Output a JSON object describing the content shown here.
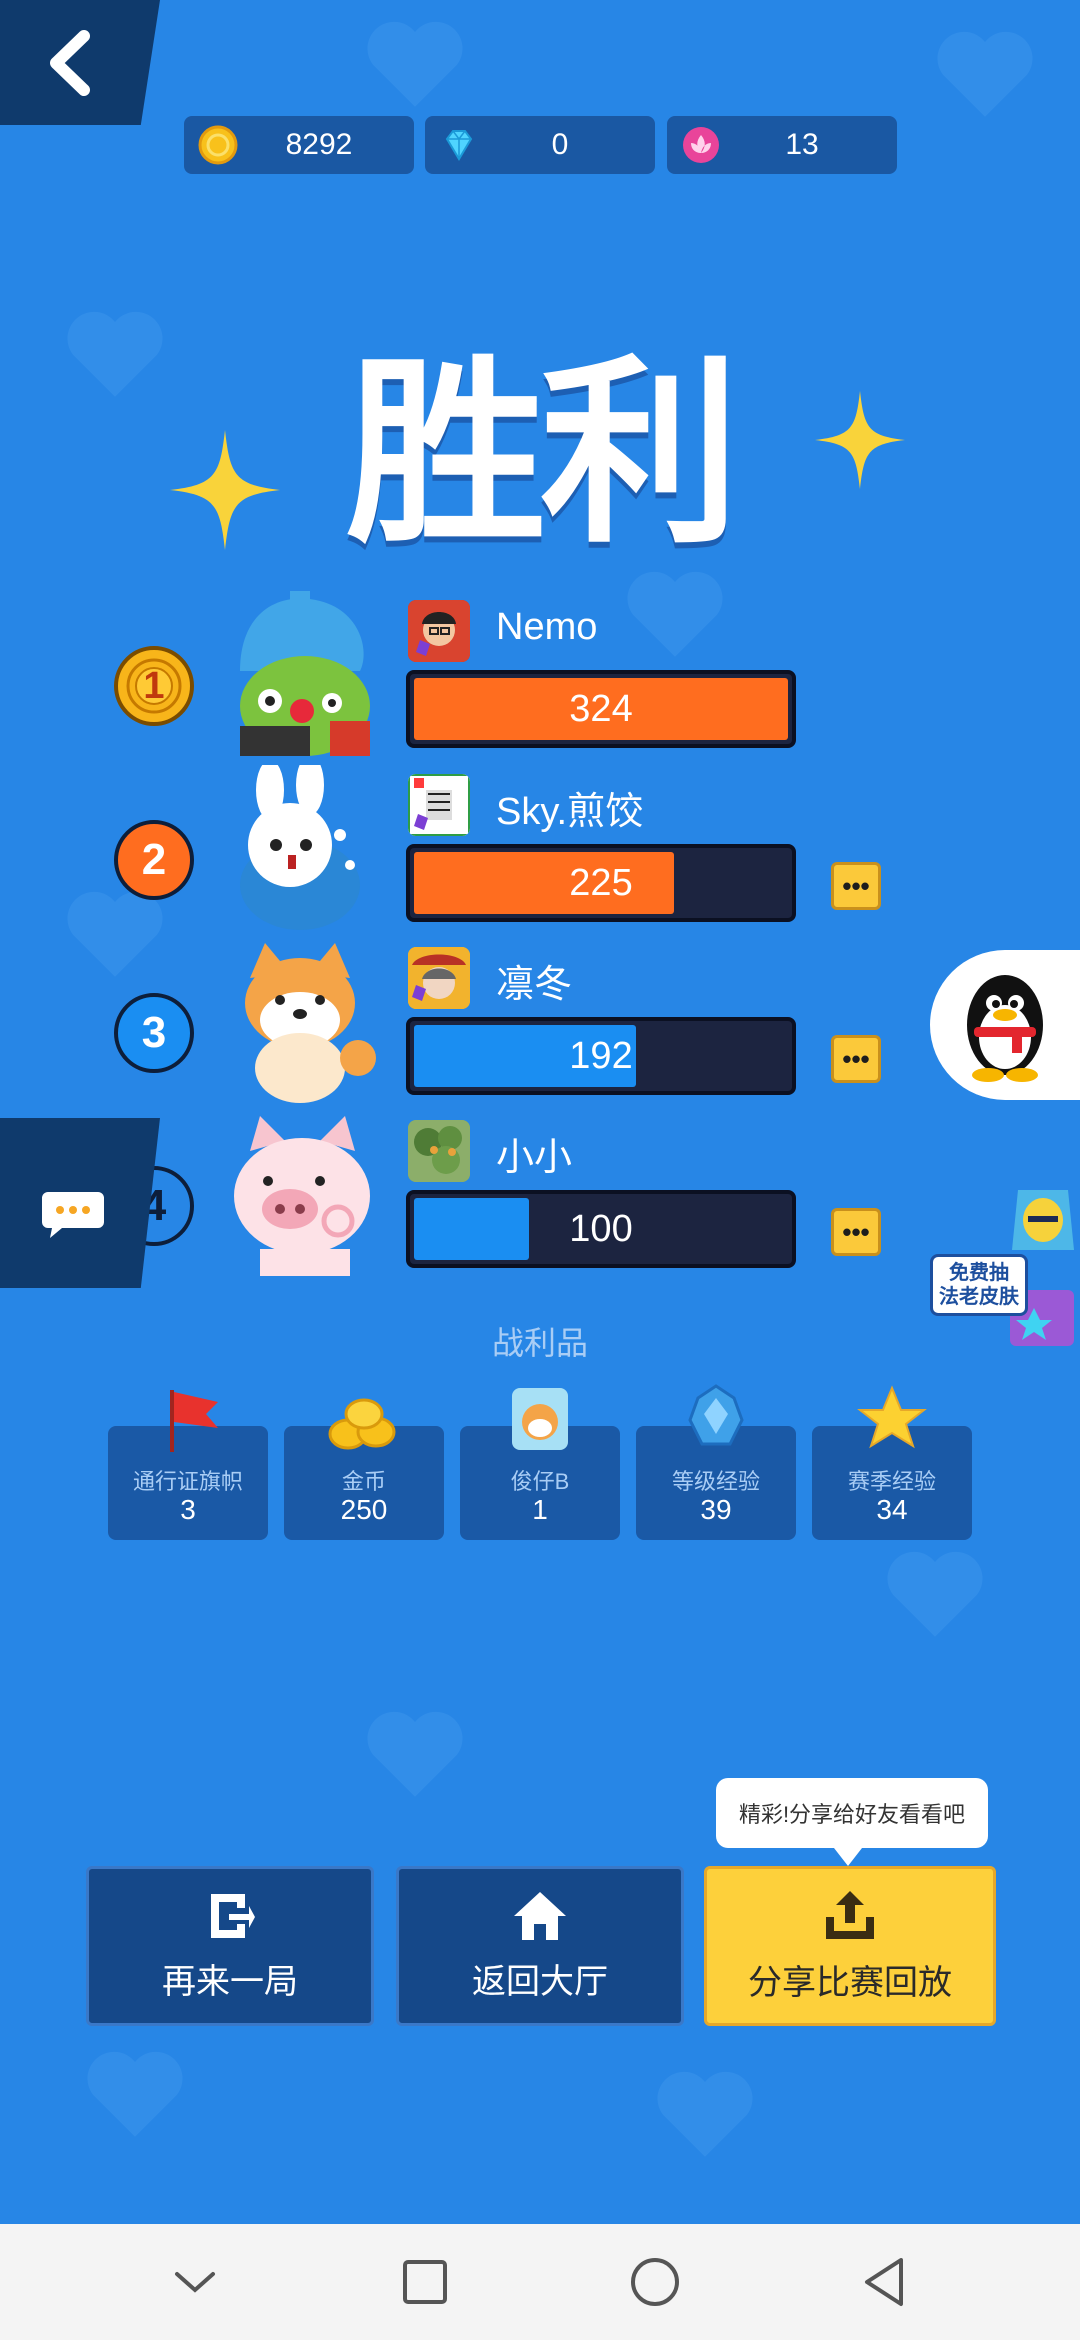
{
  "currencies": [
    {
      "icon": "gold-coin-icon",
      "value": "8292"
    },
    {
      "icon": "diamond-icon",
      "value": "0"
    },
    {
      "icon": "lotus-token-icon",
      "value": "13"
    }
  ],
  "result_title": "胜利",
  "players": [
    {
      "rank": "1",
      "name": "Nemo",
      "score": 324,
      "score_text": "324",
      "max": 324,
      "bar_color": "#ff6d1f",
      "rank_color": "#f8b51a"
    },
    {
      "rank": "2",
      "name": "Sky.煎饺",
      "score": 225,
      "score_text": "225",
      "max": 324,
      "bar_color": "#ff6d1f",
      "rank_color": "#ff6d1f"
    },
    {
      "rank": "3",
      "name": "凛冬",
      "score": 192,
      "score_text": "192",
      "max": 324,
      "bar_color": "#1a8ef2",
      "rank_color": "#1a8ef2"
    },
    {
      "rank": "4",
      "name": "小小",
      "score": 100,
      "score_text": "100",
      "max": 324,
      "bar_color": "#1a8ef2",
      "rank_color": "#2786e6"
    }
  ],
  "loot": {
    "title": "战利品",
    "items": [
      {
        "name": "通行证旗帜",
        "value": "3",
        "icon": "red-flag-icon"
      },
      {
        "name": "金币",
        "value": "250",
        "icon": "coin-pile-icon"
      },
      {
        "name": "俊仔B",
        "value": "1",
        "icon": "character-card-icon"
      },
      {
        "name": "等级经验",
        "value": "39",
        "icon": "blue-crystal-icon"
      },
      {
        "name": "赛季经验",
        "value": "34",
        "icon": "yellow-star-icon"
      }
    ]
  },
  "actions": {
    "play_again": "再来一局",
    "back_lobby": "返回大厅",
    "share_replay": "分享比赛回放",
    "share_tooltip": "精彩!分享给好友看看吧"
  },
  "promo": {
    "line1": "免费抽",
    "line2": "法老皮肤"
  },
  "colors": {
    "background": "#2786e6",
    "orange_bar": "#ff6d1f",
    "blue_bar": "#1a8ef2",
    "gold_button": "#fdd03b"
  }
}
